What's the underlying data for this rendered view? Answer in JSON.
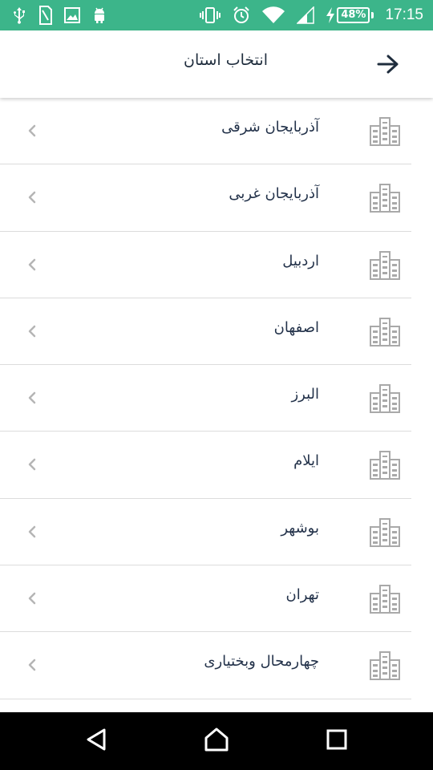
{
  "status_bar": {
    "left_icons": [
      "usb-icon",
      "sim-icon",
      "image-icon",
      "android-icon"
    ],
    "right_icons": [
      "vibrate-icon",
      "alarm-icon",
      "wifi-icon",
      "signal-icon",
      "charging-icon"
    ],
    "battery_percent": "48%",
    "time": "17:15",
    "background_color": "#3cb58a"
  },
  "app_bar": {
    "title": "انتخاب استان",
    "back_icon": "arrow-right-icon"
  },
  "provinces": [
    {
      "label": "آذربایجان شرقی"
    },
    {
      "label": "آذربایجان غربی"
    },
    {
      "label": "اردبیل"
    },
    {
      "label": "اصفهان"
    },
    {
      "label": "البرز"
    },
    {
      "label": "ایلام"
    },
    {
      "label": "بوشهر"
    },
    {
      "label": "تهران"
    },
    {
      "label": "چهارمحال وبختیاری"
    }
  ],
  "row_icon": "buildings-icon",
  "row_chevron": "chevron-left-icon",
  "nav_bar": {
    "buttons": [
      "back-triangle-icon",
      "home-icon",
      "recents-icon"
    ]
  }
}
